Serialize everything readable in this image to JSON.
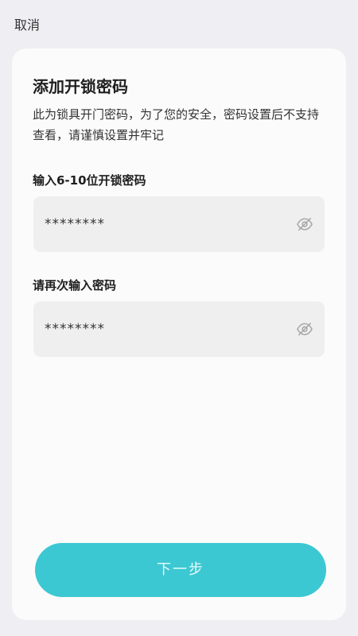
{
  "header": {
    "cancel_label": "取消"
  },
  "form": {
    "title": "添加开锁密码",
    "description": "此为锁具开门密码，为了您的安全，密码设置后不支持查看，请谨慎设置并牢记",
    "password": {
      "label": "输入6-10位开锁密码",
      "value": "********",
      "visibility_icon": "eye-off-icon"
    },
    "confirm_password": {
      "label": "请再次输入密码",
      "value": "********",
      "visibility_icon": "eye-off-icon"
    },
    "next_label": "下一步"
  },
  "colors": {
    "accent": "#3cc8d2",
    "background": "#eeeef3",
    "card": "#fbfbfb",
    "field": "#efefef"
  }
}
